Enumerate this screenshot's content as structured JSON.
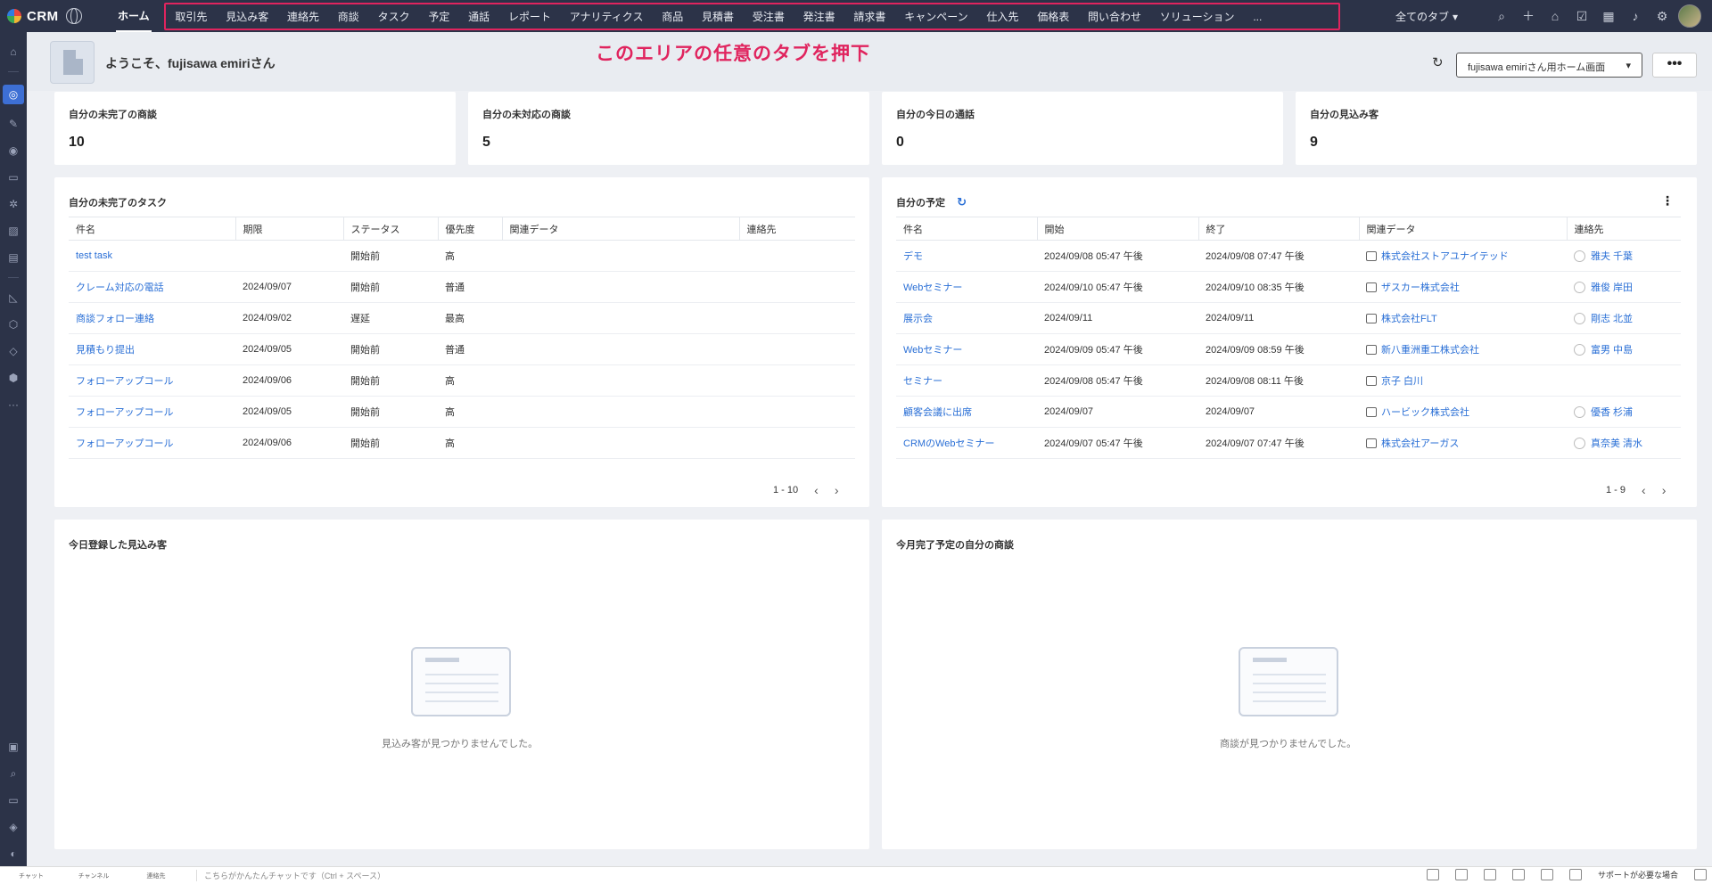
{
  "app": {
    "name": "CRM"
  },
  "nav": {
    "home": "ホーム",
    "tabs": [
      "取引先",
      "見込み客",
      "連絡先",
      "商談",
      "タスク",
      "予定",
      "通話",
      "レポート",
      "アナリティクス",
      "商品",
      "見積書",
      "受注書",
      "発注書",
      "請求書",
      "キャンペーン",
      "仕入先",
      "価格表",
      "問い合わせ",
      "ソリューション",
      "..."
    ],
    "all_tabs": "全てのタブ",
    "icons": [
      "search-icon",
      "plus-icon",
      "marketplace-icon",
      "check-icon",
      "calendar-icon",
      "bell-icon",
      "gear-icon"
    ]
  },
  "annotation": "このエリアの任意のタブを押下",
  "welcome": "ようこそ、fujisawa emiriさん",
  "layout_select": "fujisawa emiriさん用ホーム画面",
  "more": "•••",
  "kpis": [
    {
      "title": "自分の未完了の商談",
      "value": "10"
    },
    {
      "title": "自分の未対応の商談",
      "value": "5"
    },
    {
      "title": "自分の今日の通話",
      "value": "0"
    },
    {
      "title": "自分の見込み客",
      "value": "9"
    }
  ],
  "tasks": {
    "title": "自分の未完了のタスク",
    "columns": [
      "件名",
      "期限",
      "ステータス",
      "優先度",
      "関連データ",
      "連絡先"
    ],
    "rows": [
      [
        "test task",
        "",
        "開始前",
        "高",
        "",
        ""
      ],
      [
        "クレーム対応の電話",
        "2024/09/07",
        "開始前",
        "普通",
        "",
        ""
      ],
      [
        "商談フォロー連絡",
        "2024/09/02",
        "遅延",
        "最高",
        "",
        ""
      ],
      [
        "見積もり提出",
        "2024/09/05",
        "開始前",
        "普通",
        "",
        ""
      ],
      [
        "フォローアップコール",
        "2024/09/06",
        "開始前",
        "高",
        "",
        ""
      ],
      [
        "フォローアップコール",
        "2024/09/05",
        "開始前",
        "高",
        "",
        ""
      ],
      [
        "フォローアップコール",
        "2024/09/06",
        "開始前",
        "高",
        "",
        ""
      ]
    ],
    "pager": "1 - 10"
  },
  "events": {
    "title": "自分の予定",
    "columns": [
      "件名",
      "開始",
      "終了",
      "関連データ",
      "連絡先"
    ],
    "rows": [
      [
        "デモ",
        "2024/09/08 05:47 午後",
        "2024/09/08 07:47 午後",
        "株式会社ストアユナイテッド",
        "雅夫 千葉"
      ],
      [
        "Webセミナー",
        "2024/09/10 05:47 午後",
        "2024/09/10 08:35 午後",
        "ザスカー株式会社",
        "雅俊 岸田"
      ],
      [
        "展示会",
        "2024/09/11",
        "2024/09/11",
        "株式会社FLT",
        "剛志 北並"
      ],
      [
        "Webセミナー",
        "2024/09/09 05:47 午後",
        "2024/09/09 08:59 午後",
        "新八重洲重工株式会社",
        "富男 中島"
      ],
      [
        "セミナー",
        "2024/09/08 05:47 午後",
        "2024/09/08 08:11 午後",
        "京子 白川",
        ""
      ],
      [
        "顧客会議に出席",
        "2024/09/07",
        "2024/09/07",
        "ハービック株式会社",
        "優香 杉浦"
      ],
      [
        "CRMのWebセミナー",
        "2024/09/07 05:47 午後",
        "2024/09/07 07:47 午後",
        "株式会社アーガス",
        "真奈美 清水"
      ]
    ],
    "pager": "1 - 9"
  },
  "leads_today": {
    "title": "今日登録した見込み客",
    "empty": "見込み客が見つかりませんでした。"
  },
  "deals_month": {
    "title": "今月完了予定の自分の商談",
    "empty": "商談が見つかりませんでした。"
  },
  "bottom": {
    "items": [
      "チャット",
      "チャンネル",
      "連絡先"
    ],
    "chat_placeholder": "こちらがかんたんチャットです（Ctrl + スペース）",
    "support": "サポートが必要な場合"
  }
}
